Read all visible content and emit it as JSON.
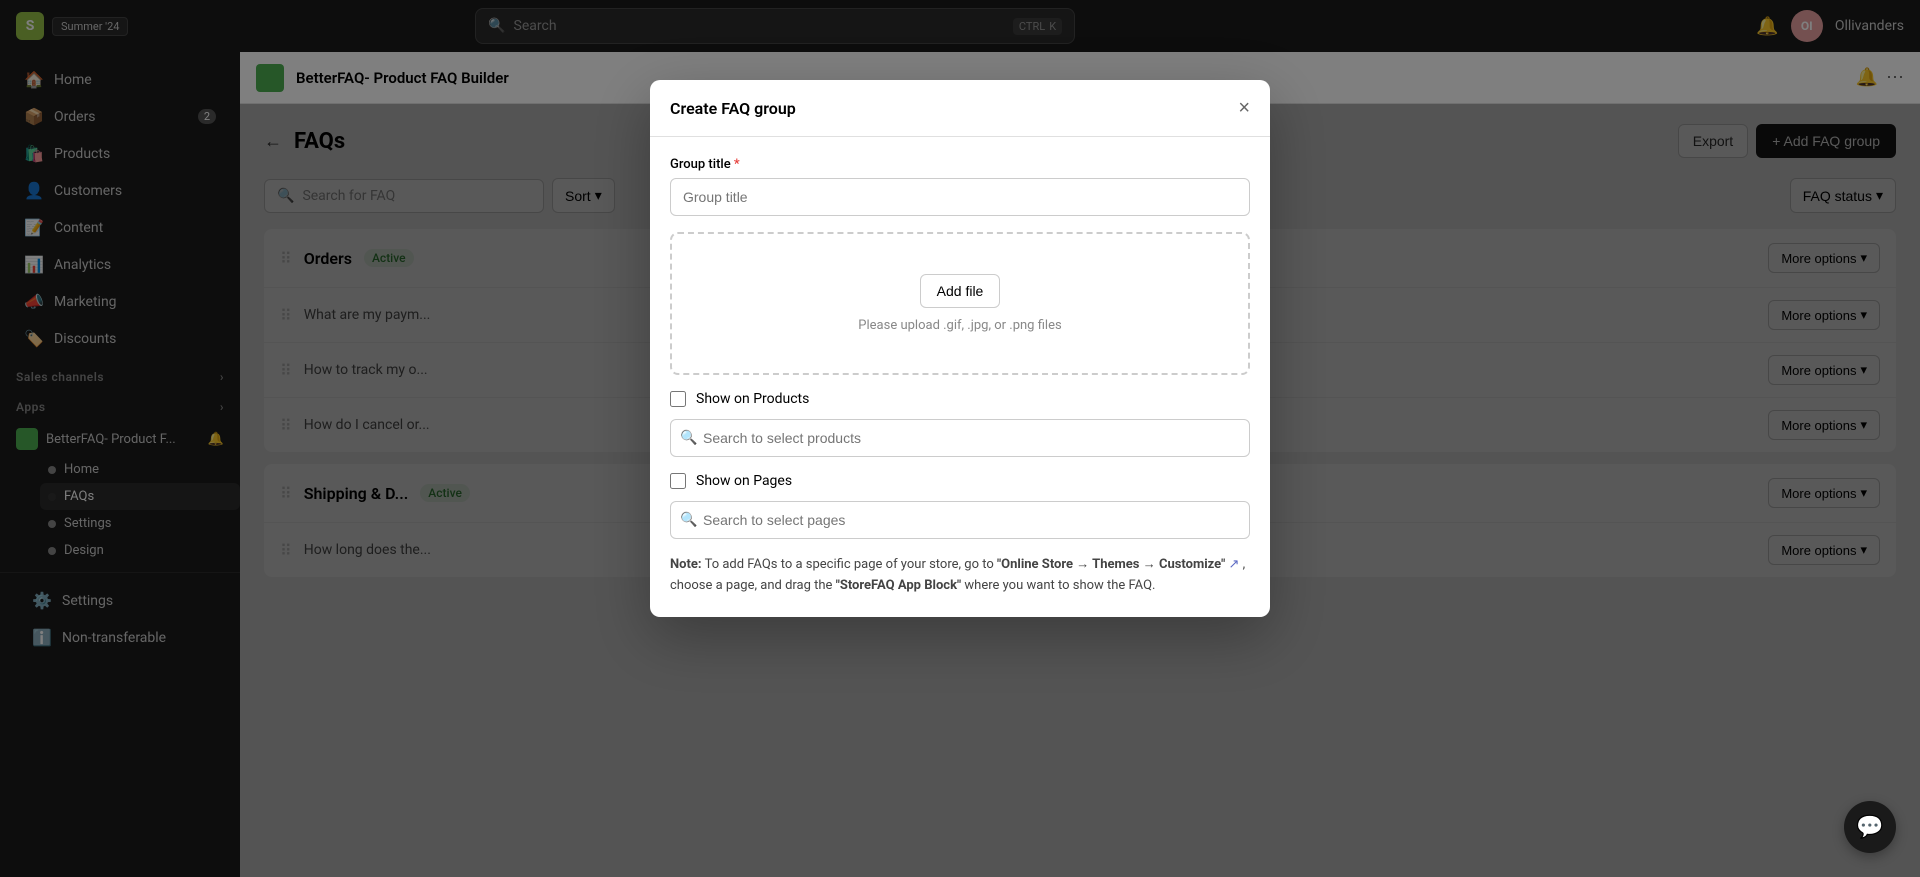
{
  "topnav": {
    "logo_letter": "S",
    "badge_label": "Summer '24",
    "search_placeholder": "Search",
    "shortcut": [
      "CTRL",
      "K"
    ],
    "bell_icon": "🔔",
    "avatar_initials": "OI",
    "store_name": "Ollivanders"
  },
  "sidebar": {
    "items": [
      {
        "id": "home",
        "label": "Home",
        "icon": "🏠"
      },
      {
        "id": "orders",
        "label": "Orders",
        "icon": "📦",
        "badge": "2"
      },
      {
        "id": "products",
        "label": "Products",
        "icon": "🛍️"
      },
      {
        "id": "customers",
        "label": "Customers",
        "icon": "👤"
      },
      {
        "id": "content",
        "label": "Content",
        "icon": "📝"
      },
      {
        "id": "analytics",
        "label": "Analytics",
        "icon": "📊"
      },
      {
        "id": "marketing",
        "label": "Marketing",
        "icon": "📣"
      },
      {
        "id": "discounts",
        "label": "Discounts",
        "icon": "🏷️"
      }
    ],
    "sales_channels_label": "Sales channels",
    "sales_channels_expand": "›",
    "apps_label": "Apps",
    "apps_expand": "›",
    "app_name": "BetterFAQ- Product F...",
    "app_sub_items": [
      {
        "id": "home",
        "label": "Home"
      },
      {
        "id": "faqs",
        "label": "FAQs",
        "active": true
      },
      {
        "id": "settings",
        "label": "Settings"
      },
      {
        "id": "design",
        "label": "Design"
      }
    ],
    "settings_label": "Settings",
    "non_transferable_label": "Non-transferable"
  },
  "app_header": {
    "title": "BetterFAQ- Product FAQ Builder",
    "bell_icon": "🔔",
    "more_icon": "⋯"
  },
  "page": {
    "back_label": "←",
    "title": "FAQs",
    "export_label": "Export",
    "add_faq_group_label": "+ Add FAQ group",
    "search_placeholder": "Search for FAQ",
    "filter_sort_label": "Sort",
    "filter_dropdown_label": "▼",
    "faq_status_label": "FAQ status",
    "faq_groups": [
      {
        "id": "orders",
        "title": "Orders",
        "status": "Active",
        "more_options": "More options",
        "items": [
          {
            "text": "What are my paym..."
          },
          {
            "text": "How to track my o..."
          },
          {
            "text": "How do I cancel or..."
          }
        ]
      },
      {
        "id": "shipping",
        "title": "Shipping & D...",
        "status": "Active",
        "more_options": "More options",
        "items": [
          {
            "text": "How long does the..."
          }
        ]
      }
    ],
    "more_options_rows": [
      "More options",
      "More options",
      "More options",
      "More options",
      "More options",
      "More options",
      "More options"
    ]
  },
  "modal": {
    "title": "Create FAQ group",
    "close_icon": "×",
    "group_title_label": "Group title",
    "group_title_required": "*",
    "group_title_placeholder": "Group title",
    "add_file_label": "Add file",
    "upload_hint": "Please upload .gif, .jpg, or .png files",
    "show_on_products_label": "Show on Products",
    "products_search_placeholder": "Search to select products",
    "show_on_pages_label": "Show on Pages",
    "pages_search_placeholder": "Search to select pages",
    "note_prefix": "Note:",
    "note_text": " To add FAQs to a specific page of your store, go to ",
    "note_link": "\"Online Store → Themes → Customize\"",
    "note_link2": " ↗",
    "note_suffix": ", choose a page, and drag the ",
    "note_bold": "\"StoreFAQ App Block\"",
    "note_end": " where you want to show the FAQ."
  },
  "chat": {
    "icon": "💬"
  }
}
